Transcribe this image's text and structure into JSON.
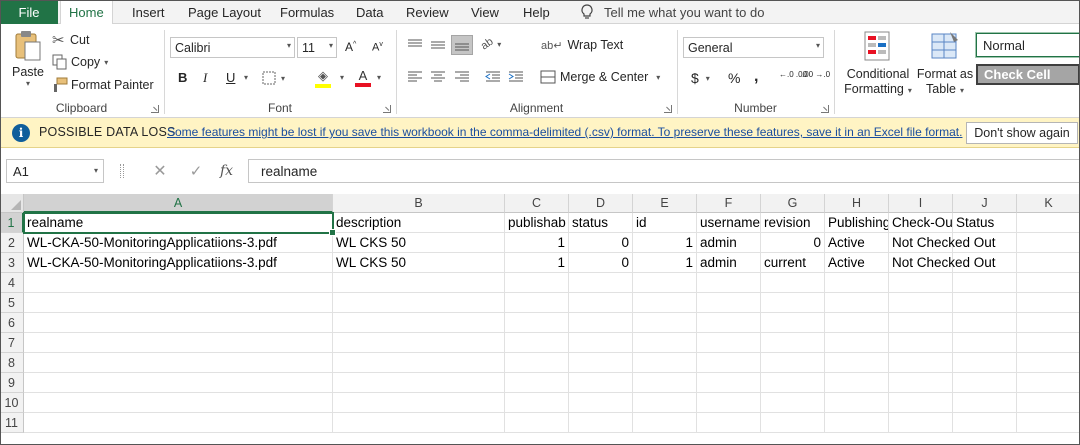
{
  "tabs": [
    "File",
    "Home",
    "Insert",
    "Page Layout",
    "Formulas",
    "Data",
    "Review",
    "View",
    "Help"
  ],
  "active_tab": "Home",
  "tell_me": "Tell me what you want to do",
  "ribbon": {
    "clipboard": {
      "label": "Clipboard",
      "paste": "Paste",
      "cut": "Cut",
      "copy": "Copy",
      "format_painter": "Format Painter"
    },
    "font": {
      "label": "Font",
      "font_name": "Calibri",
      "font_size": "11",
      "bold": "B",
      "italic": "I",
      "underline": "U"
    },
    "alignment": {
      "label": "Alignment",
      "wrap_text": "Wrap Text",
      "merge_center": "Merge & Center"
    },
    "number": {
      "label": "Number",
      "format": "General",
      "currency": "$",
      "percent": "%",
      "comma": ",",
      "increase_decimal": "←.0 .00",
      "decrease_decimal": ".00 →.0"
    },
    "styles": {
      "conditional_formatting_1": "Conditional",
      "conditional_formatting_2": "Formatting",
      "format_as_table_1": "Format as",
      "format_as_table_2": "Table",
      "style_normal": "Normal",
      "style_check_cell": "Check Cell"
    }
  },
  "infobar": {
    "title": "POSSIBLE DATA LOSS",
    "message": "Some features might be lost if you save this workbook in the comma-delimited (.csv) format. To preserve these features, save it in an Excel file format.",
    "button": "Don't show again"
  },
  "formula_bar": {
    "name_box": "A1",
    "fx": "fx",
    "content": "realname"
  },
  "sheet": {
    "columns": [
      "A",
      "B",
      "C",
      "D",
      "E",
      "F",
      "G",
      "H",
      "I",
      "J",
      "K"
    ],
    "row_numbers": [
      "1",
      "2",
      "3",
      "4",
      "5",
      "6",
      "7",
      "8",
      "9",
      "10",
      "11"
    ],
    "rows": [
      [
        "realname",
        "description",
        "publishab",
        "status",
        "id",
        "username",
        "revision",
        "Publishing",
        "Check-Out",
        "Status",
        ""
      ],
      [
        "WL-CKA-50-MonitoringApplicatiions-3.pdf",
        "WL CKS 50",
        "1",
        "0",
        "1",
        "admin",
        "0",
        "Active",
        "Not Checked Out",
        "",
        ""
      ],
      [
        "WL-CKA-50-MonitoringApplicatiions-3.pdf",
        "WL CKS 50",
        "1",
        "0",
        "1",
        "admin",
        "current",
        "Active",
        "Not Checked Out",
        "",
        ""
      ]
    ]
  },
  "colors": {
    "excel_green": "#217346",
    "infobar_bg": "#fff4c4",
    "link_blue": "#1a4d9e"
  }
}
